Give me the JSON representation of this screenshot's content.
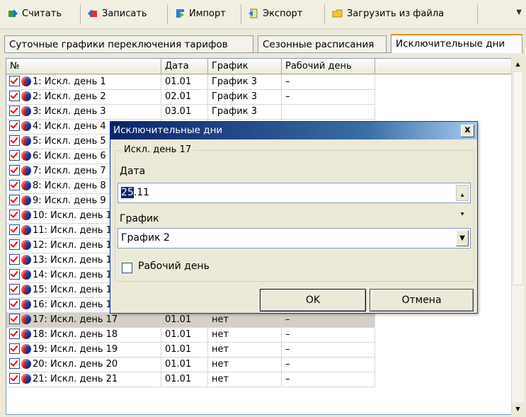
{
  "toolbar": {
    "read_label": "Считать",
    "write_label": "Записать",
    "import_label": "Импорт",
    "export_label": "Экспорт",
    "load_label": "Загрузить из файла"
  },
  "tabs": [
    {
      "label": "Суточные графики переключения тарифов",
      "active": false
    },
    {
      "label": "Сезонные расписания",
      "active": false
    },
    {
      "label": "Исключительные дни",
      "active": true
    }
  ],
  "grid": {
    "columns": [
      "№",
      "Дата",
      "График",
      "Рабочий день"
    ],
    "rows": [
      {
        "name": "1: Искл. день 1",
        "date": "01.01",
        "schedule": "График 3",
        "workday": "–"
      },
      {
        "name": "2: Искл. день 2",
        "date": "02.01",
        "schedule": "График 3",
        "workday": "–"
      },
      {
        "name": "3: Искл. день 3",
        "date": "03.01",
        "schedule": "График 3",
        "workday": ""
      },
      {
        "name": "4: Искл. день 4",
        "date": "",
        "schedule": "",
        "workday": ""
      },
      {
        "name": "5: Искл. день 5",
        "date": "",
        "schedule": "",
        "workday": ""
      },
      {
        "name": "6: Искл. день 6",
        "date": "",
        "schedule": "",
        "workday": ""
      },
      {
        "name": "7: Искл. день 7",
        "date": "",
        "schedule": "",
        "workday": ""
      },
      {
        "name": "8: Искл. день 8",
        "date": "",
        "schedule": "",
        "workday": ""
      },
      {
        "name": "9: Искл. день 9",
        "date": "",
        "schedule": "",
        "workday": ""
      },
      {
        "name": "10: Искл. день 10",
        "date": "",
        "schedule": "",
        "workday": ""
      },
      {
        "name": "11: Искл. день 11",
        "date": "",
        "schedule": "",
        "workday": ""
      },
      {
        "name": "12: Искл. день 12",
        "date": "",
        "schedule": "",
        "workday": ""
      },
      {
        "name": "13: Искл. день 13",
        "date": "",
        "schedule": "",
        "workday": ""
      },
      {
        "name": "14: Искл. день 14",
        "date": "",
        "schedule": "",
        "workday": ""
      },
      {
        "name": "15: Искл. день 15",
        "date": "",
        "schedule": "",
        "workday": ""
      },
      {
        "name": "16: Искл. день 16",
        "date": "01.01",
        "schedule": "нет",
        "workday": "–"
      },
      {
        "name": "17: Искл. день 17",
        "date": "01.01",
        "schedule": "нет",
        "workday": "–",
        "selected": true
      },
      {
        "name": "18: Искл. день 18",
        "date": "01.01",
        "schedule": "нет",
        "workday": "–"
      },
      {
        "name": "19: Искл. день 19",
        "date": "01.01",
        "schedule": "нет",
        "workday": "–"
      },
      {
        "name": "20: Искл. день 20",
        "date": "01.01",
        "schedule": "нет",
        "workday": "–"
      },
      {
        "name": "21: Искл. день 21",
        "date": "01.01",
        "schedule": "нет",
        "workday": "–"
      }
    ]
  },
  "dialog": {
    "title": "Исключительные дни",
    "close_label": "x",
    "group_title": "Искл. день 17",
    "date_label": "Дата",
    "date_value_selected": "25",
    "date_value_rest": ".11",
    "schedule_label": "График",
    "schedule_value": "График 2",
    "workday_label": "Рабочий день",
    "workday_checked": false,
    "ok_label": "OK",
    "cancel_label": "Отмена"
  },
  "colors": {
    "title_bar_start": "#0a246a",
    "title_bar_end": "#a6caf0",
    "check_mark": "#e0001c",
    "selected_row": "#d4d0c8"
  }
}
